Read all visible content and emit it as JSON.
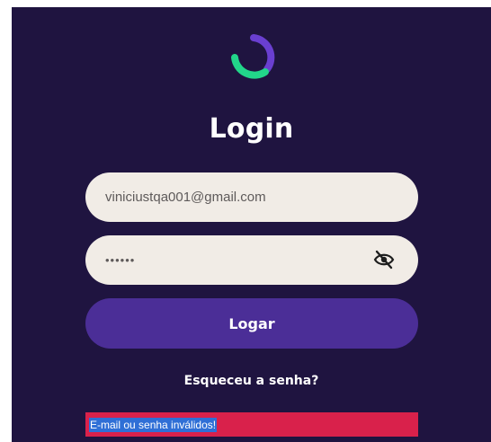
{
  "login": {
    "title": "Login",
    "email": {
      "value": "viniciustqa001@gmail.com",
      "placeholder": ""
    },
    "password": {
      "value": "••••••",
      "placeholder": ""
    },
    "submit_label": "Logar",
    "forgot_label": "Esqueceu a senha?",
    "error_message": "E-mail ou senha inválidos!"
  },
  "colors": {
    "background": "#1f1440",
    "logo_green": "#22d68a",
    "logo_purple": "#6a3fd0",
    "field": "#f1ece6",
    "button": "#4b2e97",
    "error": "#d9214b",
    "selection": "#2f6fd6"
  },
  "icons": {
    "logo": "circle-arc-logo",
    "password_toggle": "eye-slash-icon"
  }
}
